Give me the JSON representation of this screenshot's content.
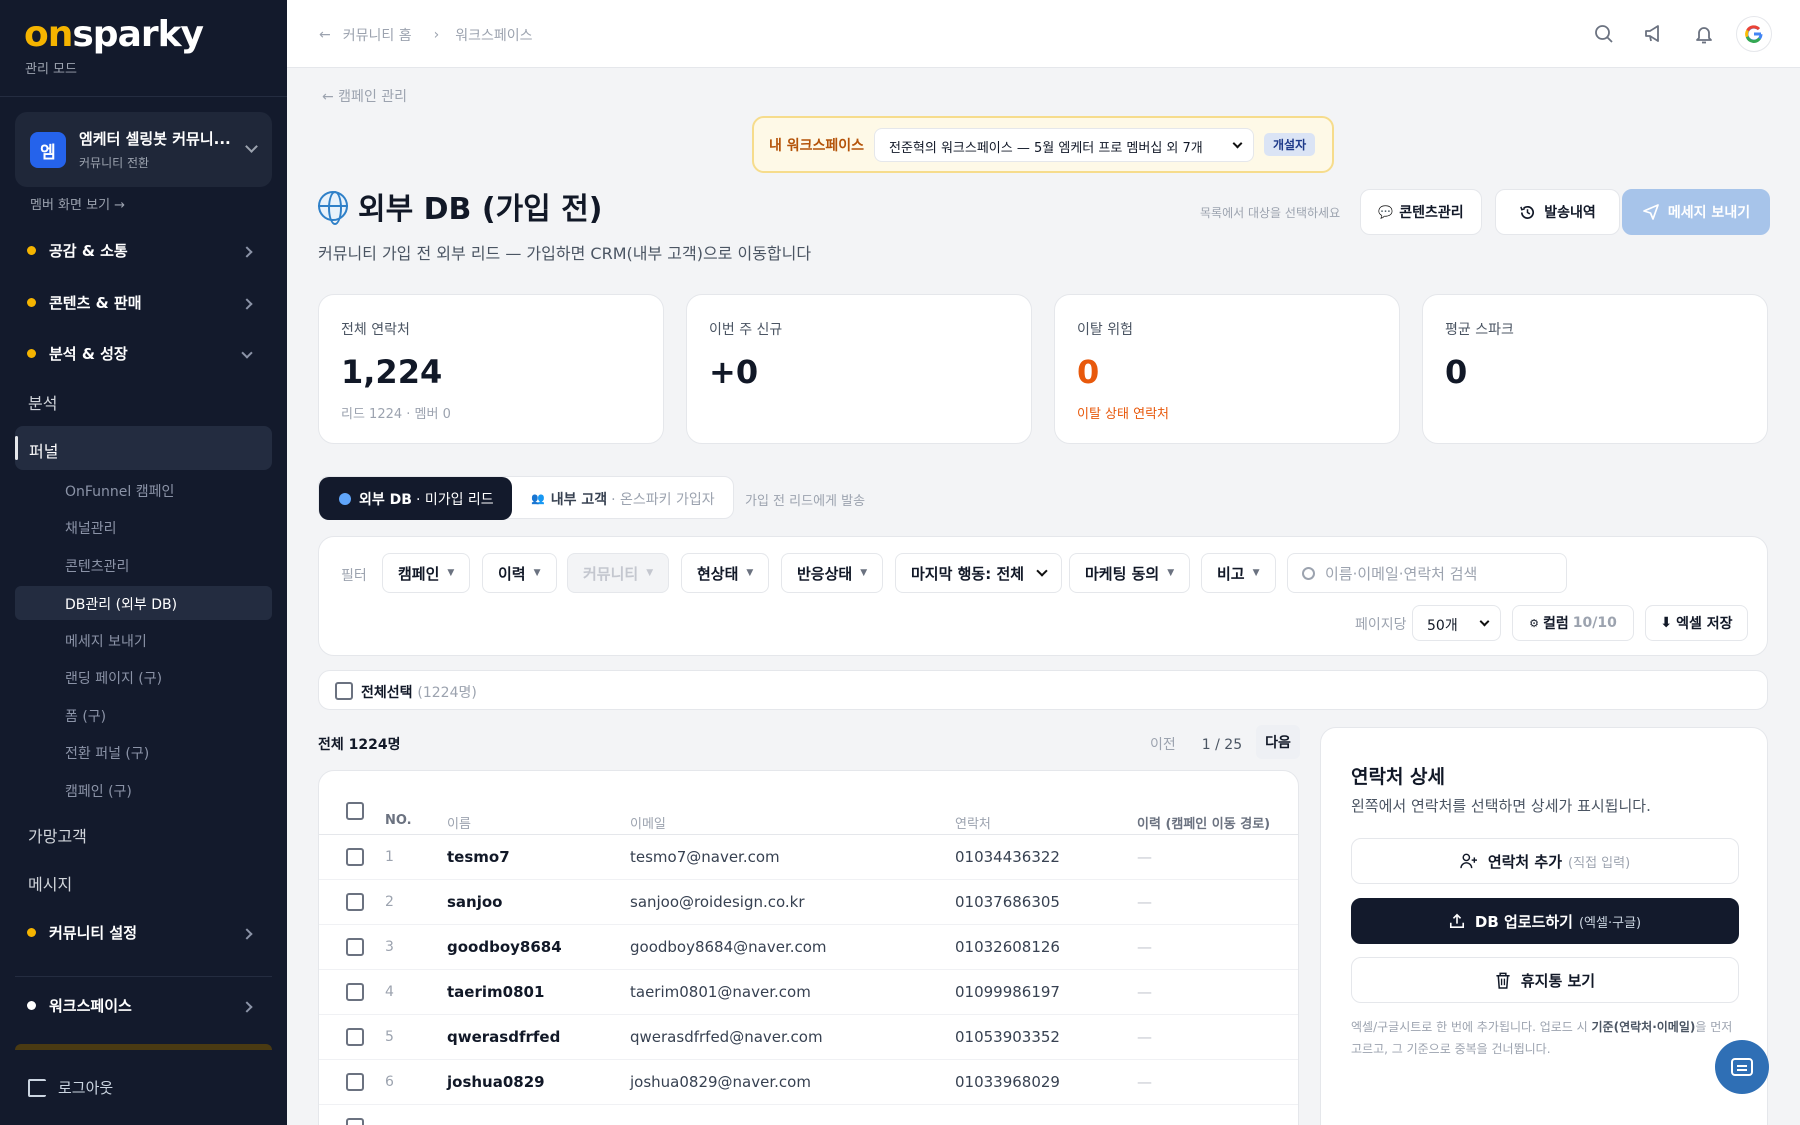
{
  "sidebar": {
    "logo_on": "on",
    "logo_rest": "sparky",
    "mode": "관리 모드",
    "community": {
      "avatar": "엠",
      "name": "엠케터 셀링봇 커뮤니...",
      "sub": "커뮤니티 전환"
    },
    "member_view": "멤버 화면 보기 →",
    "sections": [
      {
        "label": "공감 & 소통"
      },
      {
        "label": "콘텐츠 & 판매"
      },
      {
        "label": "분석 & 성장"
      }
    ],
    "analysis": "분석",
    "funnel": "퍼널",
    "funnel_items": [
      "OnFunnel 캠페인",
      "채널관리",
      "콘텐츠관리",
      "DB관리 (외부 DB)",
      "메세지 보내기",
      "랜딩 페이지 (구)",
      "폼 (구)",
      "전환 퍼널 (구)",
      "캠페인 (구)"
    ],
    "prospects": "가망고객",
    "message": "메시지",
    "community_settings": "커뮤니티 설정",
    "workspace": "워크스페이스",
    "logout": "로그아웃"
  },
  "topbar": {
    "crumb_home": "커뮤니티 홈",
    "crumb_current": "워크스페이스",
    "icons": [
      "search-icon",
      "megaphone-icon",
      "bell-icon",
      "google-avatar"
    ]
  },
  "main": {
    "back_link": "← 캠페인 관리",
    "workspace_banner": {
      "label": "내 워크스페이스",
      "selected": "전준혁의 워크스페이스 — 5월 엠케터 프로 멤버십 외 7개",
      "badge": "개설자"
    },
    "title": "외부 DB (가입 전)",
    "description": "커뮤니티 가입 전 외부 리드 — 가입하면 CRM(내부 고객)으로 이동합니다",
    "hint": "목록에서 대상을 선택하세요",
    "buttons": {
      "content": "콘텐츠관리",
      "history": "발송내역",
      "send": "메세지 보내기"
    },
    "stats": [
      {
        "title": "전체 연락처",
        "value": "1,224",
        "sub": "리드 1224 · 멤버 0"
      },
      {
        "title": "이번 주 신규",
        "value": "+0",
        "sub": ""
      },
      {
        "title": "이탈 위험",
        "value": "0",
        "sub": "이탈 상태 연락처"
      },
      {
        "title": "평균 스파크",
        "value": "0",
        "sub": ""
      }
    ],
    "tabs": {
      "active_bold": "외부 DB",
      "active_rest": "· 미가입 리드",
      "inactive_bold": "내부 고객",
      "inactive_rest": "· 온스파키 가입자",
      "hint": "가입 전 리드에게 발송"
    },
    "filters": {
      "label": "필터",
      "chips": [
        "캠페인",
        "이력",
        "커뮤니티",
        "현상태",
        "반응상태"
      ],
      "last_action": "마지막 행동: 전체",
      "chips2": [
        "마케팅 동의",
        "비고"
      ],
      "search_placeholder": "이름·이메일·연락처 검색",
      "per_page_label": "페이지당",
      "per_page": "50개",
      "columns_label": "컬럼",
      "columns_value": "10/10",
      "excel": "엑셀 저장"
    },
    "select_all": {
      "label": "전체선택",
      "count": "(1224명)"
    },
    "total": "전체 1224명",
    "pager": {
      "prev": "이전",
      "position": "1 / 25",
      "next": "다음"
    },
    "table": {
      "headers": [
        "NO.",
        "이름",
        "이메일",
        "연락처",
        "이력 (캠페인 이동 경로)"
      ],
      "rows": [
        {
          "no": "1",
          "name": "tesmo7",
          "email": "tesmo7@naver.com",
          "phone": "01034436322",
          "history": "—"
        },
        {
          "no": "2",
          "name": "sanjoo",
          "email": "sanjoo@roidesign.co.kr",
          "phone": "01037686305",
          "history": "—"
        },
        {
          "no": "3",
          "name": "goodboy8684",
          "email": "goodboy8684@naver.com",
          "phone": "01032608126",
          "history": "—"
        },
        {
          "no": "4",
          "name": "taerim0801",
          "email": "taerim0801@naver.com",
          "phone": "01099986197",
          "history": "—"
        },
        {
          "no": "5",
          "name": "qwerasdfrfed",
          "email": "qwerasdfrfed@naver.com",
          "phone": "01053903352",
          "history": "—"
        },
        {
          "no": "6",
          "name": "joshua0829",
          "email": "joshua0829@naver.com",
          "phone": "01033968029",
          "history": "—"
        }
      ]
    },
    "detail": {
      "title": "연락처 상세",
      "desc": "왼쪽에서 연락처를 선택하면 상세가 표시됩니다.",
      "add_label": "연락처 추가",
      "add_hint": "(직접 입력)",
      "upload_label": "DB 업로드하기",
      "upload_hint": "(엑셀·구글)",
      "trash": "휴지통 보기",
      "foot_1": "엑셀/구글시트로 한 번에 추가됩니다. 업로드 시 ",
      "foot_bold": "기준(연락처·이메일)",
      "foot_2": "을 먼저 고르고, 그 기준으로 중복을 건너뜁니다."
    }
  },
  "colors": {
    "sidebar_bg": "#131a2c",
    "accent_gold": "#f5b400",
    "warning_orange": "#e8590c",
    "primary_disabled": "#a7c4ea"
  }
}
